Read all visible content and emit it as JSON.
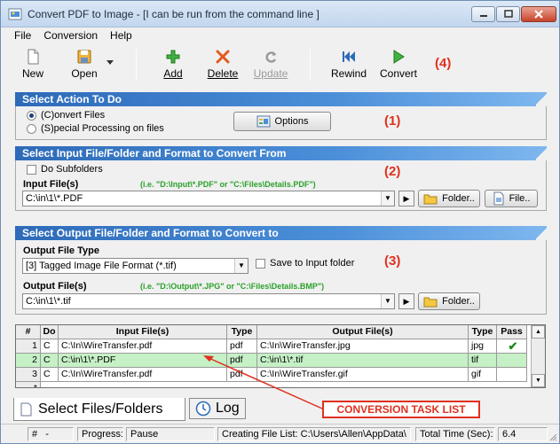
{
  "window": {
    "title": "Convert PDF to Image - [I can be run from the command line ]"
  },
  "menu": {
    "items": [
      "File",
      "Conversion",
      "Help"
    ]
  },
  "toolbar": {
    "new": "New",
    "open": "Open",
    "add": "Add",
    "delete": "Delete",
    "update": "Update",
    "rewind": "Rewind",
    "convert": "Convert",
    "step": "(4)"
  },
  "action": {
    "header": "Select Action To Do",
    "convert_files": "(C)onvert Files",
    "special": "(S)pecial Processing on files",
    "options": "Options",
    "step": "(1)"
  },
  "input": {
    "header": "Select Input File/Folder and Format to Convert From",
    "subfolders": "Do Subfolders",
    "label": "Input File(s)",
    "hint": "(i.e. \"D:\\Input\\*.PDF\"  or  \"C:\\Files\\Details.PDF\")",
    "value": "C:\\in\\1\\*.PDF",
    "folder_btn": "Folder..",
    "file_btn": "File..",
    "step": "(2)"
  },
  "output": {
    "header": "Select Output File/Folder and Format to Convert to",
    "type_label": "Output File Type",
    "type_value": "[3] Tagged Image File Format (*.tif)",
    "save_input": "Save to Input folder",
    "label": "Output File(s)",
    "hint": "(i.e. \"D:\\Output\\*.JPG\"  or  \"C:\\Files\\Details.BMP\")",
    "value": "C:\\in\\1\\*.tif",
    "folder_btn": "Folder..",
    "step": "(3)"
  },
  "grid": {
    "headers": [
      "#",
      "Do",
      "Input File(s)",
      "Type",
      "Output File(s)",
      "Type",
      "Pass"
    ],
    "rows": [
      {
        "num": "1",
        "do": "C",
        "input": "C:\\In\\WireTransfer.pdf",
        "itype": "pdf",
        "output": "C:\\In\\WireTransfer.jpg",
        "otype": "jpg",
        "pass": "✔"
      },
      {
        "num": "2",
        "do": "C",
        "input": "C:\\in\\1\\*.PDF",
        "itype": "pdf",
        "output": "C:\\in\\1\\*.tif",
        "otype": "tif",
        "pass": ""
      },
      {
        "num": "3",
        "do": "C",
        "input": "C:\\In\\WireTransfer.pdf",
        "itype": "pdf",
        "output": "C:\\In\\WireTransfer.gif",
        "otype": "gif",
        "pass": ""
      },
      {
        "num": "*",
        "do": "",
        "input": "",
        "itype": "",
        "output": "",
        "otype": "",
        "pass": ""
      }
    ],
    "highlight_color": "#c6f0c6"
  },
  "tabs": {
    "files": "Select Files/Folders",
    "log": "Log"
  },
  "annotation": {
    "task_list": "CONVERSION TASK LIST"
  },
  "status": {
    "hash": "#",
    "hash_val": "-",
    "progress": "Progress:",
    "pause": "Pause",
    "creating": "Creating File List: C:\\Users\\Allen\\AppData\\",
    "total_time": "Total Time (Sec):",
    "time_val": "6.4"
  },
  "colors": {
    "accent": "#2d6ab8",
    "step": "#e0301e",
    "hint": "#2aa12a"
  }
}
